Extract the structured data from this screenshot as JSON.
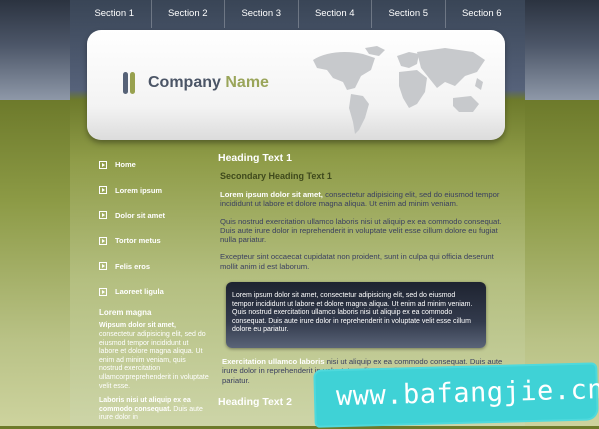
{
  "nav": [
    "Section 1",
    "Section 2",
    "Section 3",
    "Section 4",
    "Section 5",
    "Section 6"
  ],
  "logo": {
    "company": "Company",
    "name": "Name"
  },
  "sidebar": {
    "items": [
      "Home",
      "Lorem ipsum",
      "Dolor sit amet",
      "Tortor metus",
      "Felis eros",
      "Laoreet ligula"
    ],
    "heading": "Lorem magna",
    "para1_bold": "Wipsum dolor sit amet,",
    "para1": "consectetur adipisicing elit, sed do eiusmod tempor incididunt ut labore et dolore magna aliqua. Ut enim ad minim veniam, quis nostrud exercitation ullamcorpreprehenderit in voluptate velit esse.",
    "para2_bold": "Laboris nisi ut aliquip ex ea commodo consequat.",
    "para2": "Duis aute irure dolor in"
  },
  "main": {
    "heading1": "Heading Text 1",
    "subheading": "Secondary Heading Text 1",
    "p1_bold": "Lorem ipsum dolor sit amet,",
    "p1": "consectetur adipisicing elit, sed do eiusmod tempor incididunt ut labore et dolore magna aliqua. Ut enim ad minim veniam.",
    "p2": "Quis nostrud exercitation ullamco laboris nisi ut aliquip ex ea commodo consequat. Duis aute irure dolor in reprehenderit in voluptate velit esse cillum dolore eu fugiat nulla pariatur.",
    "p3": "Excepteur sint occaecat cupidatat non proident, sunt in culpa qui officia deserunt mollit anim id est laborum.",
    "box": "Lorem ipsum dolor sit amet, consectetur adipisicing elit, sed do eiusmod tempor incididunt ut labore et dolore magna aliqua. Ut enim ad minim veniam. Quis nostrud exercitation ullamco laboris nisi ut aliquip ex ea commodo consequat. Duis aute irure dolor in reprehenderit in voluptate velit esse cillum dolore eu pariatur.",
    "p4_bold": "Exercitation ullamco laboris",
    "p4": "nisi ut aliquip ex ea commodo consequat. Duis aute irure dolor in reprehenderit in voluptate velit esse cillum dolore eu fugiat nulla pariatur.",
    "heading2": "Heading Text 2"
  },
  "watermark": "www.bafangjie.cn"
}
